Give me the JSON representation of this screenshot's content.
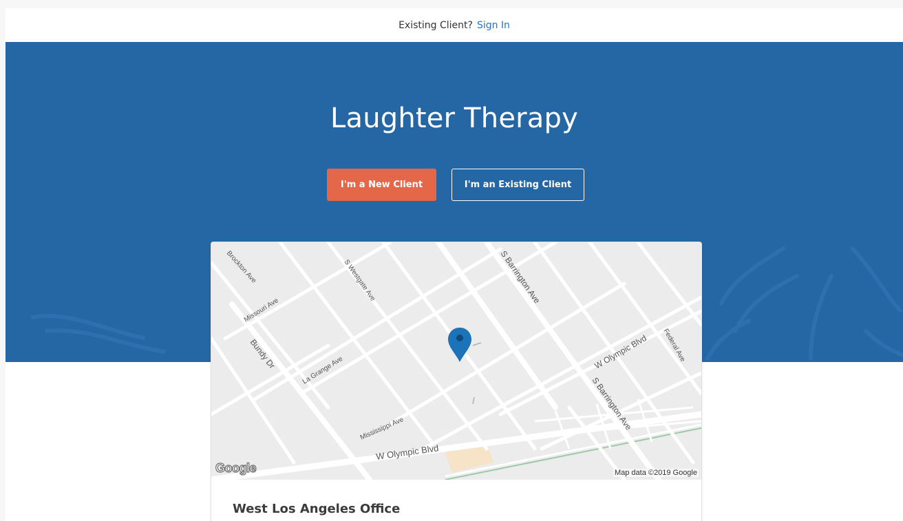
{
  "topbar": {
    "prompt": "Existing Client?",
    "signin_label": "Sign In"
  },
  "hero": {
    "title": "Laughter Therapy",
    "new_client_label": "I'm a New Client",
    "existing_client_label": "I'm an Existing Client"
  },
  "map": {
    "roads": {
      "brockton": "Brockton Ave",
      "missouri": "Missouri Ave",
      "westgate": "S Westgate Ave",
      "barrington_top": "S Barrington Ave",
      "bundy": "Bundy Dr",
      "lagrange": "La Grange Ave",
      "olympic_right": "W Olympic Blvd",
      "federal": "Federal Ave",
      "barrington_bottom": "S Barrington Ave",
      "mississippi": "Mississippi Ave",
      "olympic_bottom": "W Olympic Blvd"
    },
    "logo": "Google",
    "credit": "Map data ©2019 Google",
    "marker_icon": "map-pin-icon"
  },
  "office": {
    "name": "West Los Angeles Office"
  },
  "colors": {
    "hero_bg": "#2566a4",
    "accent": "#e5674a",
    "link": "#1f75c9",
    "marker": "#1c73b8"
  }
}
